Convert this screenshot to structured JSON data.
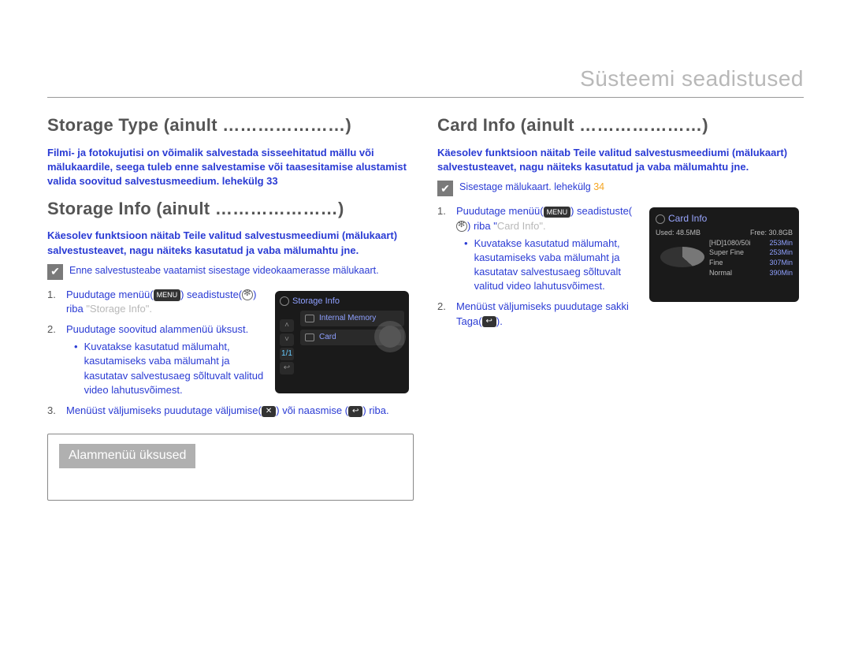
{
  "header": {
    "title": "Süsteemi seadistused"
  },
  "left": {
    "h1": "Storage Type (ainult …………………)",
    "p1": "Filmi- ja fotokujutisi on võimalik salvestada sisseehitatud mällu või mälukaardile, seega tuleb enne salvestamise või taasesitamise alustamist valida soovitud salvestusmeedium.  lehekülg 33",
    "h2": "Storage Info (ainult …………………)",
    "p2": "Käesolev funktsioon näitab Teile valitud salvestusmeediumi (mälukaart) salvestusteavet, nagu näiteks kasutatud ja vaba mälumahtu jne.",
    "note": "Enne salvestusteabe vaatamist sisestage videokaamerasse mälukaart.",
    "steps": {
      "s1a": "Puudutage menüü(",
      "s1b": ") seadistuste(",
      "s1c": ") riba",
      "s1q": "  \"Storage Info\".",
      "s2": "Puudutage soovitud alammenüü üksust.",
      "s2bul": "Kuvatakse kasutatud mälumaht, kasutamiseks vaba mälumaht ja kasutatav salvestusaeg sõltuvalt valitud video lahutusvõimest.",
      "s3a": "Menüüst väljumiseks puudutage väljumise(",
      "s3b": ") või naasmise (",
      "s3c": ") riba."
    },
    "fig": {
      "title": "Storage Info",
      "row1": "Internal Memory",
      "row2": "Card"
    },
    "box_head": "Alammenüü üksused"
  },
  "right": {
    "h1": "Card Info (ainult …………………)",
    "p1": "Käesolev funktsioon näitab Teile valitud salvestusmeediumi (mälukaart) salvestusteavet, nagu näiteks kasutatud ja vaba mälumahtu jne.",
    "note_a": "Sisestage mälukaart.  lehekülg ",
    "note_pg": "34",
    "steps": {
      "s1a": "Puudutage menüü(",
      "s1b": ") seadistuste(",
      "s1c": ") riba   \"",
      "s1q": "Card Info",
      "s1d": "\".",
      "s1bul": "Kuvatakse kasutatud mälumaht, kasutamiseks vaba mälumaht ja kasutatav salvestusaeg sõltuvalt valitud video lahutusvõimest.",
      "s2a": "Menüüst väljumiseks puudutage sakki Taga(",
      "s2b": ")."
    },
    "card": {
      "title": "Card Info",
      "used_l": "Used:",
      "used_v": "48.5MB",
      "free_l": "Free:",
      "free_v": "30.8GB",
      "r1a": "[HD]1080/50i",
      "r1b": "253Min",
      "r2a": "Super Fine",
      "r2b": "253Min",
      "r3a": "Fine",
      "r3b": "307Min",
      "r4a": "Normal",
      "r4b": "390Min"
    }
  },
  "icons": {
    "menu": "MENU",
    "back": "↩",
    "x": "✕"
  }
}
